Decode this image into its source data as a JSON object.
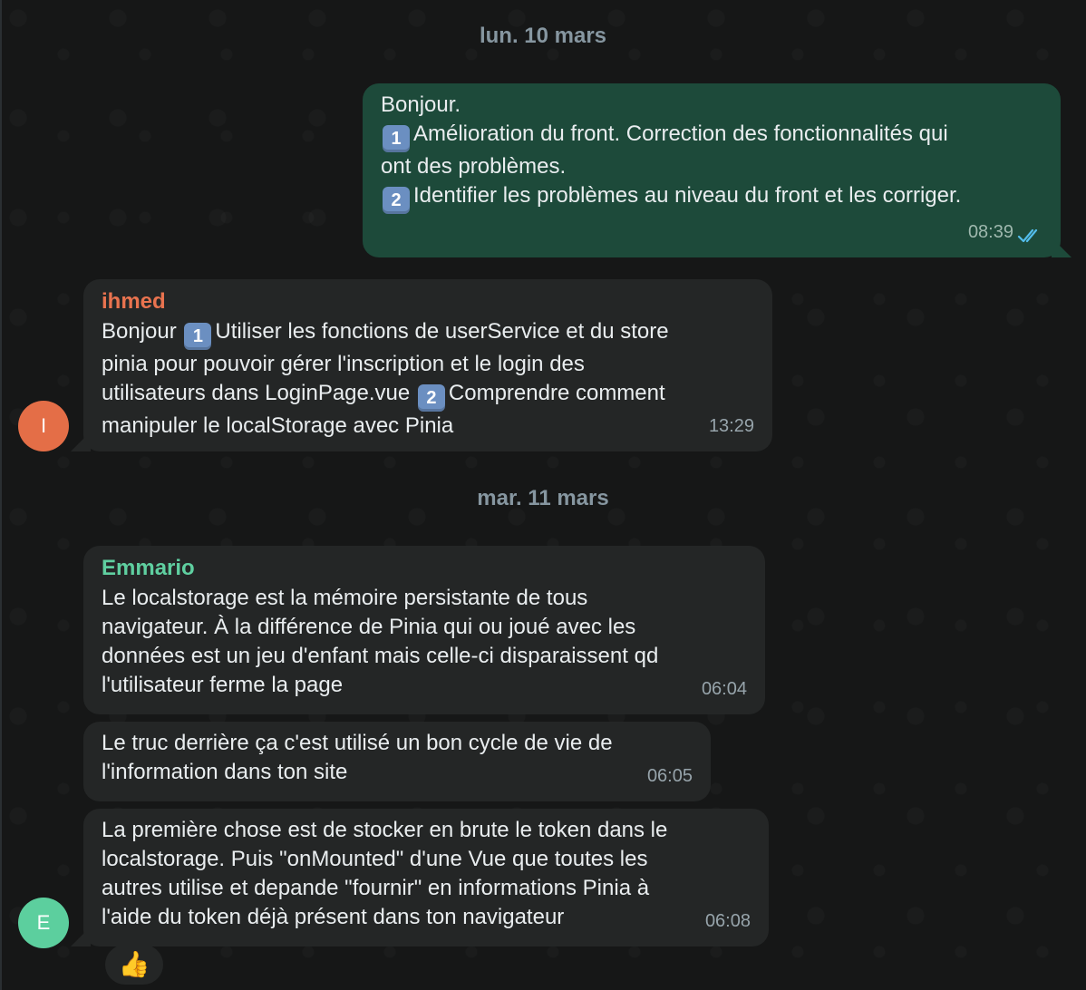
{
  "dates": {
    "first": "lun. 10 mars",
    "second": "mar. 11 mars"
  },
  "messages": [
    {
      "direction": "outgoing",
      "lines": [
        "Bonjour.",
        "Amélioration du front. Correction des fonctionnalités qui",
        "ont des problèmes.",
        "Identifier les problèmes au niveau du front et les corriger."
      ],
      "line_badges": [
        "",
        "1",
        "",
        "2"
      ],
      "time": "08:39",
      "status": "read"
    },
    {
      "direction": "incoming",
      "sender": "ihmed",
      "sender_color": "#e9734f",
      "line1_pre": "Bonjour ",
      "line1_badge": "1",
      "line1_post": "Utiliser les fonctions de userService et du store",
      "line2": "pinia pour pouvoir gérer l'inscription et le login des",
      "line3_pre": "utilisateurs dans LoginPage.vue ",
      "line3_badge": "2",
      "line3_post": "Comprendre comment",
      "line4": "manipuler le localStorage avec Pinia",
      "time": "13:29",
      "avatar_initial": "I",
      "avatar_color": "#e46e47"
    },
    {
      "direction": "incoming",
      "sender": "Emmario",
      "sender_color": "#5fcfa0",
      "lines": [
        "Le localstorage est la mémoire persistante de tous",
        "navigateur. À la différence de Pinia qui ou joué avec les",
        "données est un jeu d'enfant mais celle-ci disparaissent qd",
        "l'utilisateur ferme la page"
      ],
      "time": "06:04"
    },
    {
      "direction": "incoming",
      "lines": [
        "Le truc derrière ça c'est utilisé un bon cycle de vie de",
        "l'information dans ton site"
      ],
      "time": "06:05"
    },
    {
      "direction": "incoming",
      "lines": [
        "La première chose est de stocker en brute le token dans le",
        "localstorage. Puis \"onMounted\" d'une Vue que toutes les",
        "autres utilise et depande \"fournir\" en informations Pinia à",
        "l'aide du token déjà présent dans ton navigateur"
      ],
      "time": "06:08",
      "avatar_initial": "E",
      "avatar_color": "#5ccf9e",
      "reaction": "👍"
    }
  ]
}
